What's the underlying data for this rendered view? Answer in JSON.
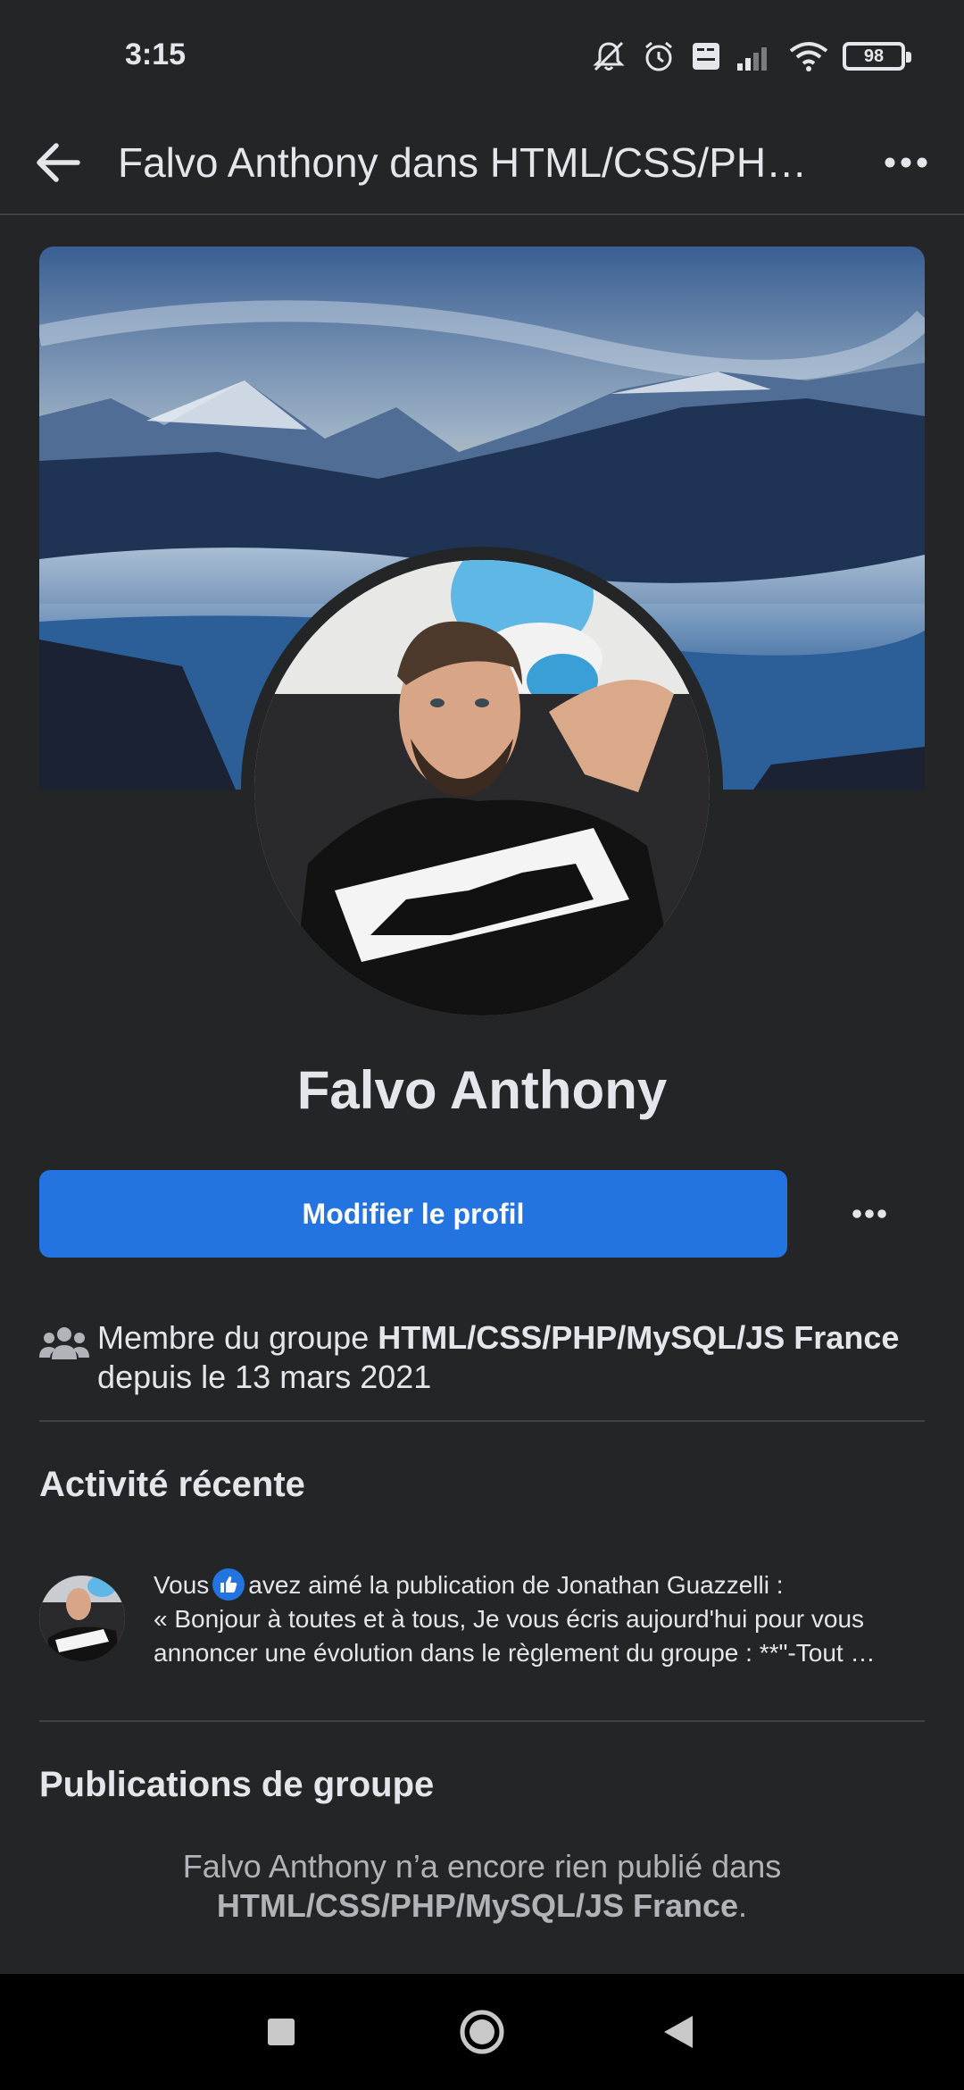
{
  "status": {
    "time": "3:15",
    "battery": "98"
  },
  "header": {
    "title": "Falvo Anthony dans HTML/CSS/PHP/MySQL/JS France"
  },
  "profile": {
    "name": "Falvo Anthony",
    "edit_button": "Modifier le profil"
  },
  "membership": {
    "prefix": "Membre du groupe ",
    "group": "HTML/CSS/PHP/MySQL/JS France",
    "suffix": " depuis le 13 mars 2021"
  },
  "recent": {
    "title": "Activité récente",
    "item": {
      "who": "Vous",
      "action": "avez aimé la publication de Jonathan Guazzelli :",
      "line2": "« Bonjour à toutes et à tous, Je vous écris aujourd'hui pour vous",
      "line3": "annoncer une évolution dans le règlement du groupe : **\"-Tout …"
    }
  },
  "posts": {
    "title": "Publications de groupe",
    "empty_prefix": "Falvo Anthony n’a encore rien publié dans ",
    "empty_group": "HTML/CSS/PHP/MySQL/JS France",
    "empty_suffix": "."
  },
  "colors": {
    "background": "#242526",
    "accent": "#2374e1",
    "text": "#e4e6eb",
    "secondary_text": "#b0b3b8",
    "divider": "#3e4042"
  },
  "icons": [
    "back-arrow-icon",
    "more-dots-icon",
    "members-group-icon",
    "like-thumb-icon",
    "notification-off-icon",
    "alarm-icon",
    "volte-icon",
    "signal-icon",
    "wifi-icon",
    "battery-icon",
    "nav-recents-icon",
    "nav-home-icon",
    "nav-back-icon"
  ]
}
